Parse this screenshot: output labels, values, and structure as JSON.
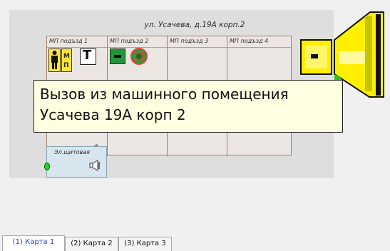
{
  "map": {
    "address": "ул. Усачева, д.19А корп.2",
    "entrances": [
      {
        "label": "МП подъзд 1"
      },
      {
        "label": "МП подъзд 2"
      },
      {
        "label": "МП подъзд 3"
      },
      {
        "label": "МП подъзд 4"
      }
    ],
    "mp_tile_letters": [
      "М",
      "П"
    ],
    "t_tile_letter": "Т",
    "switchboard_label": "Эл.щитовая"
  },
  "tooltip": {
    "line1": "Вызов из машинного помещения",
    "line2": "Усачева 19А корп 2"
  },
  "icons": {
    "alarm": "loudspeaker-icon",
    "speaker": "speaker-icon",
    "person": "person-icon",
    "radar": "radar-icon"
  },
  "colors": {
    "alarm_yellow": "#ffef00",
    "alarm_green": "#2fbf1e",
    "tooltip_bg": "#ffffe1",
    "active_tab": "#2a3cc7"
  },
  "tabs": [
    {
      "label": "(1) Карта 1",
      "active": true
    },
    {
      "label": "(2) Карта 2",
      "active": false
    },
    {
      "label": "(3) Карта 3",
      "active": false
    }
  ]
}
